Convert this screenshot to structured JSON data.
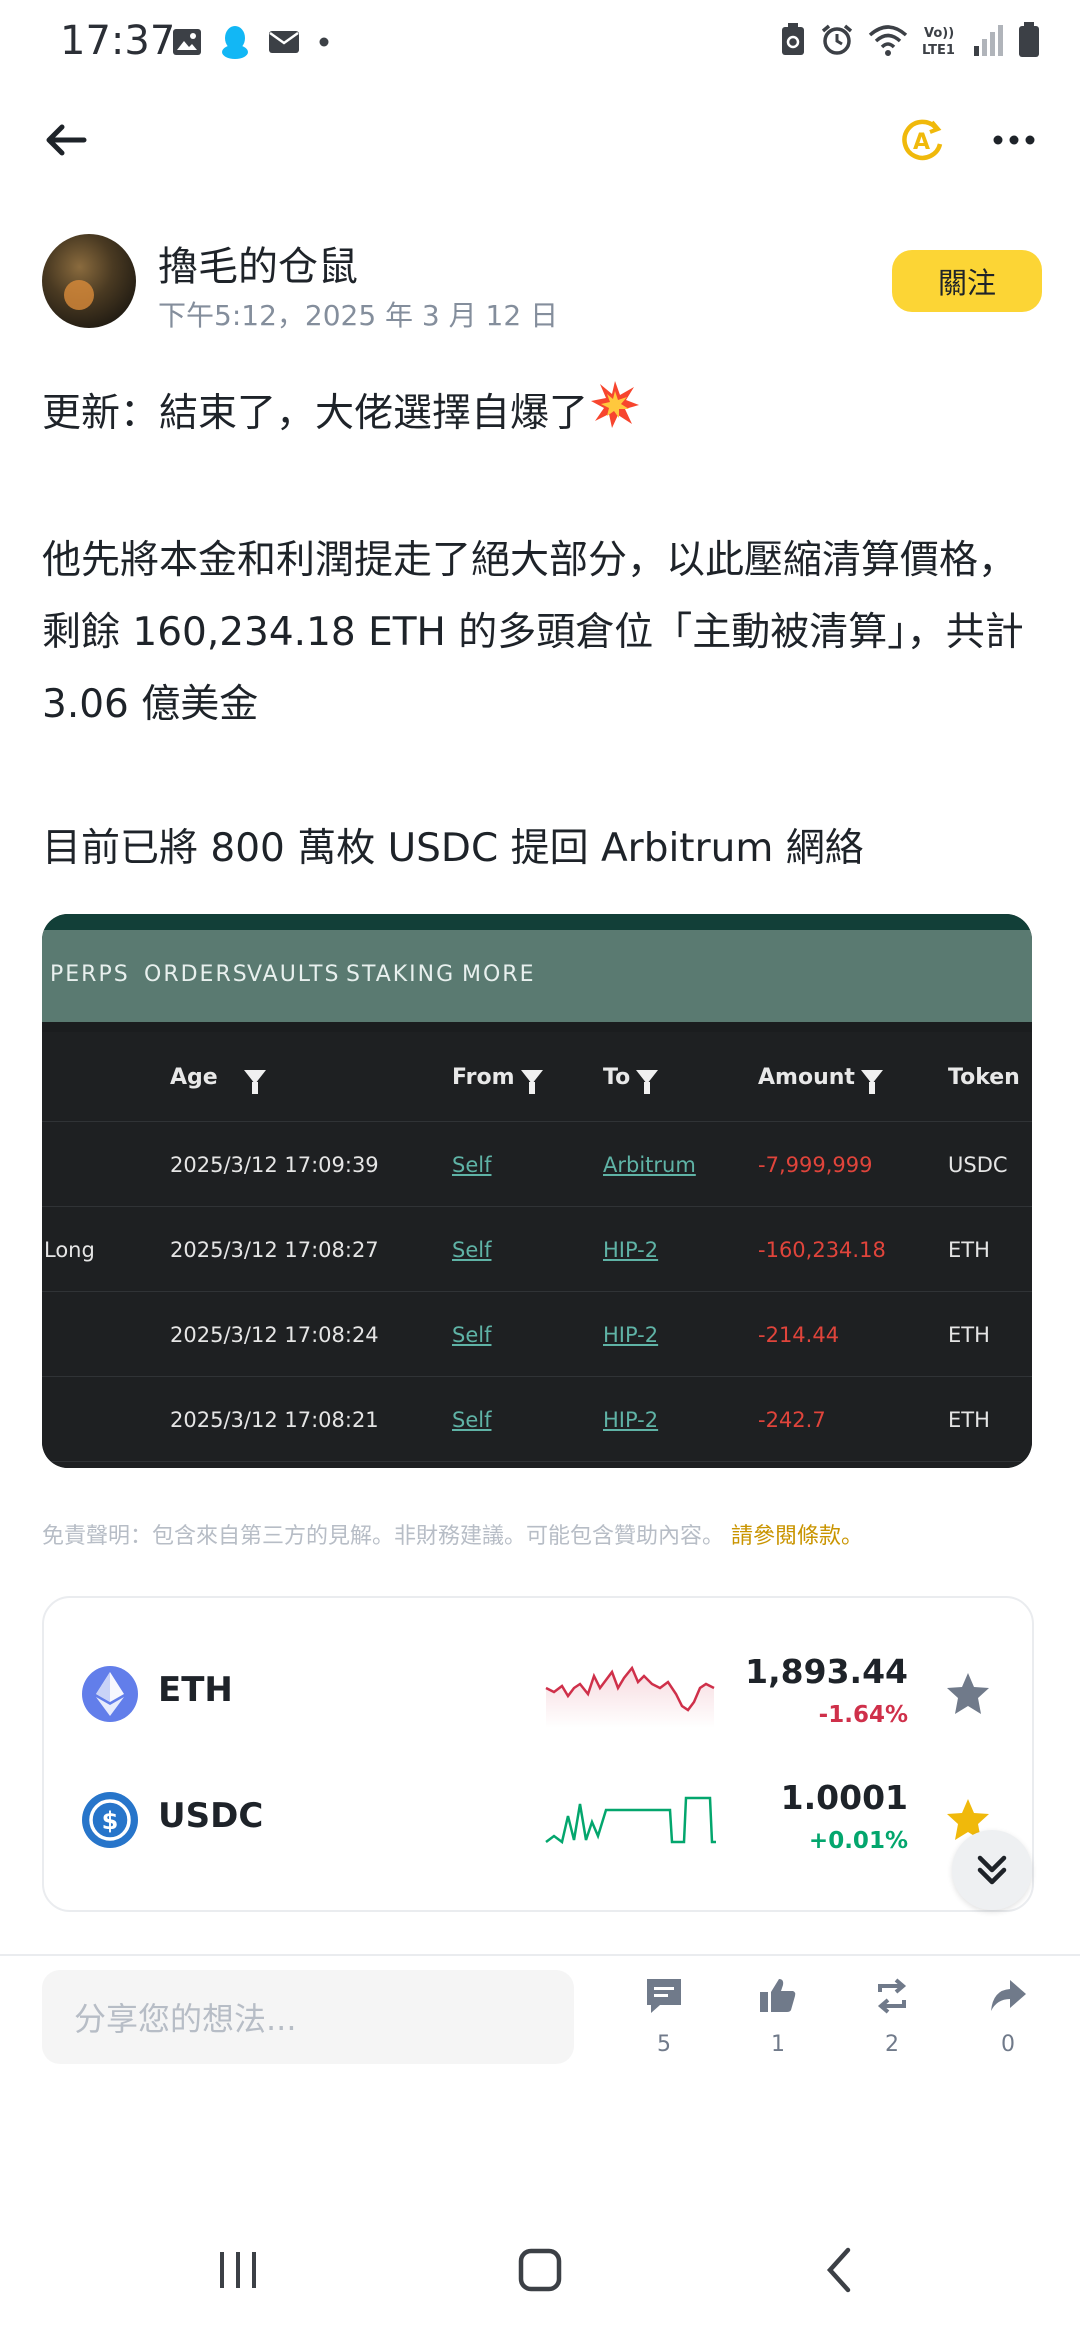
{
  "status_bar": {
    "time": "17:37"
  },
  "author": {
    "name": "擼毛的仓鼠",
    "timestamp": "下午5:12，2025 年 3 月 12 日",
    "follow_label": "關注"
  },
  "post": {
    "line1": "更新：結束了，大佬選擇自爆了",
    "para2": "他先將本金和利潤提走了絕大部分，以此壓縮清算價格，剩餘 160,234.18 ETH 的多頭倉位「主動被清算」，共計 3.06 億美金",
    "para3": "目前已將 800 萬枚 USDC 提回 Arbitrum 網絡"
  },
  "embedded_screenshot": {
    "nav": [
      "PERPS",
      "ORDERS",
      "VAULTS",
      "STAKING",
      "MORE"
    ],
    "headers": {
      "age": "Age",
      "from": "From",
      "to": "To",
      "amount": "Amount",
      "token": "Token"
    },
    "rows": [
      {
        "type": "",
        "age": "2025/3/12 17:09:39",
        "from": "Self",
        "to": "Arbitrum",
        "amount": "-7,999,999",
        "token": "USDC"
      },
      {
        "type": "Long",
        "age": "2025/3/12 17:08:27",
        "from": "Self",
        "to": "HIP-2",
        "amount": "-160,234.18",
        "token": "ETH"
      },
      {
        "type": "",
        "age": "2025/3/12 17:08:24",
        "from": "Self",
        "to": "HIP-2",
        "amount": "-214.44",
        "token": "ETH"
      },
      {
        "type": "",
        "age": "2025/3/12 17:08:21",
        "from": "Self",
        "to": "HIP-2",
        "amount": "-242.7",
        "token": "ETH"
      }
    ]
  },
  "disclaimer": {
    "text": "免責聲明：包含來自第三方的見解。非財務建議。可能包含贊助內容。",
    "link": "請參閱條款。"
  },
  "tokens": [
    {
      "symbol": "ETH",
      "price": "1,893.44",
      "change": "-1.64%",
      "change_color": "#cf304a",
      "favorited": false
    },
    {
      "symbol": "USDC",
      "price": "1.0001",
      "change": "+0.01%",
      "change_color": "#03a66d",
      "favorited": true
    }
  ],
  "comment_bar": {
    "placeholder": "分享您的想法...",
    "comments": "5",
    "likes": "1",
    "reposts": "2",
    "shares": "0"
  },
  "colors": {
    "accent": "#fcd535",
    "negative": "#cf304a",
    "positive": "#03a66d"
  }
}
